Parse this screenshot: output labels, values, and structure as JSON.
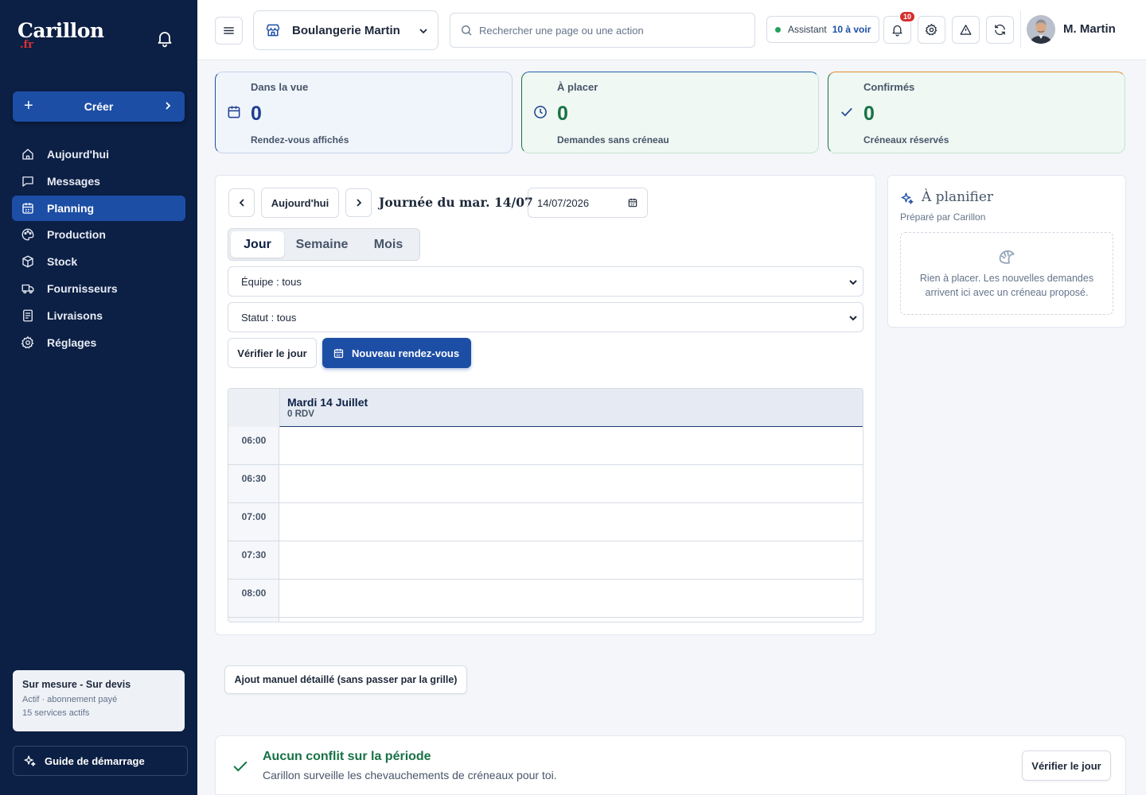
{
  "brand": {
    "name": "Carillon",
    "tld": ".fr"
  },
  "sidebar": {
    "create_label": "Créer",
    "items": [
      {
        "label": "Aujourd'hui",
        "icon": "home-icon"
      },
      {
        "label": "Messages",
        "icon": "message-icon"
      },
      {
        "label": "Planning",
        "icon": "calendar-icon",
        "active": true
      },
      {
        "label": "Production",
        "icon": "palette-icon"
      },
      {
        "label": "Stock",
        "icon": "box-icon"
      },
      {
        "label": "Fournisseurs",
        "icon": "truck-icon"
      },
      {
        "label": "Livraisons",
        "icon": "document-icon"
      },
      {
        "label": "Réglages",
        "icon": "gear-icon"
      }
    ],
    "plan": {
      "title": "Sur mesure - Sur devis",
      "status": "Actif · abonnement payé",
      "services": "15 services actifs"
    },
    "guide_label": "Guide de démarrage"
  },
  "topbar": {
    "store": "Boulangerie Martin",
    "search_placeholder": "Rechercher une page ou une action",
    "assistant_label": "Assistant",
    "assistant_count": "10 à voir",
    "notif_count": "10",
    "user_name": "M. Martin"
  },
  "stats": [
    {
      "label": "Dans la vue",
      "value": "0",
      "sub": "Rendez-vous affichés",
      "color": "#1d3f8f"
    },
    {
      "label": "À placer",
      "value": "0",
      "sub": "Demandes sans créneau",
      "color": "#177245"
    },
    {
      "label": "Confirmés",
      "value": "0",
      "sub": "Créneaux réservés",
      "color": "#177245"
    }
  ],
  "planning": {
    "today_label": "Aujourd'hui",
    "day_title": "Journée du mar. 14/07",
    "date_value": "14/07/2026",
    "views": [
      "Jour",
      "Semaine",
      "Mois"
    ],
    "active_view": "Jour",
    "team_filter": "Équipe : tous",
    "status_filter": "Statut : tous",
    "check_label": "Vérifier le jour",
    "new_label": "Nouveau rendez-vous",
    "day_header": "Mardi 14 Juillet",
    "day_count": "0 RDV",
    "slots": [
      "06:00",
      "06:30",
      "07:00",
      "07:30",
      "08:00"
    ]
  },
  "to_plan": {
    "title": "À planifier",
    "subtitle": "Préparé par Carillon",
    "empty_line1": "Rien à placer. Les nouvelles demandes",
    "empty_line2": "arrivent ici avec un créneau proposé."
  },
  "manual_label": "Ajout manuel détaillé (sans passer par la grille)",
  "conflict": {
    "title": "Aucun conflit sur la période",
    "subtitle": "Carillon surveille les chevauchements de créneaux pour toi.",
    "button": "Vérifier le jour"
  }
}
